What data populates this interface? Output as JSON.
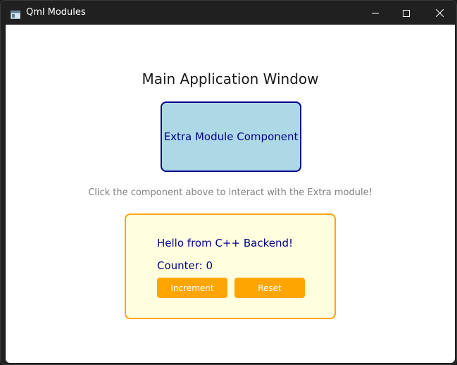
{
  "window": {
    "title": "Qml Modules"
  },
  "titlebar": {
    "app_icon": "window-icon",
    "minimize_icon": "minimize-icon",
    "maximize_icon": "maximize-icon",
    "close_icon": "close-icon"
  },
  "main": {
    "heading": "Main Application Window",
    "extra_component": {
      "label": "Extra Module Component",
      "fill_color": "#add8e6",
      "border_color": "#00008b"
    },
    "hint": "Click the component above to interact with the Extra module!",
    "backend": {
      "greeting": "Hello from C++ Backend!",
      "counter_text": "Counter: 0",
      "fill_color": "#ffffe0",
      "border_color": "#ffa500",
      "buttons": {
        "increment_label": "Increment",
        "reset_label": "Reset",
        "color": "#ffa500"
      }
    }
  }
}
